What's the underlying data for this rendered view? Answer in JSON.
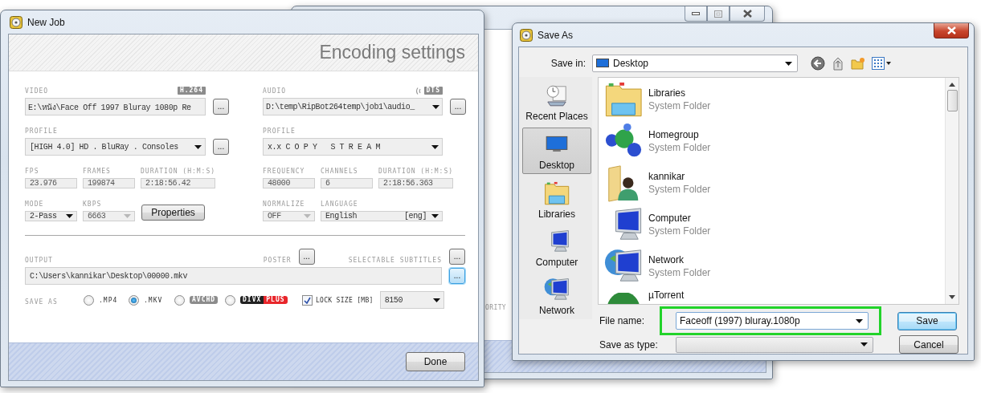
{
  "back_window": {
    "buttons": [
      {
        "kind": "minimize"
      },
      {
        "kind": "maximize"
      },
      {
        "kind": "close"
      }
    ],
    "label_fragment": "ORITY"
  },
  "new_job": {
    "title": "New Job",
    "header": "Encoding settings",
    "columns": [
      {
        "kind": "video",
        "label": "VIDEO",
        "badge": "H.264",
        "source": {
          "value": "E:\\หนัง\\Face Off 1997 Bluray 1080p Re",
          "dropdown": false
        },
        "browse": "...",
        "profile": {
          "label": "PROFILE",
          "value": "[HIGH 4.0] HD . BluRay . Consoles",
          "browse": "..."
        },
        "stats": [
          {
            "label": "FPS",
            "value": "23.976"
          },
          {
            "label": "FRAMES",
            "value": "199874"
          },
          {
            "label": "DURATION (H:M:S)",
            "value": "2:18:56.42"
          }
        ],
        "options": [
          {
            "kind": "select",
            "label": "MODE",
            "value": "2-Pass",
            "disabled": false
          },
          {
            "kind": "select",
            "label": "KBPS",
            "value": "6663",
            "disabled": true
          },
          {
            "kind": "button",
            "text": "Properties"
          }
        ]
      },
      {
        "kind": "audio",
        "label": "AUDIO",
        "badge": "DTS",
        "source": {
          "value": "D:\\temp\\RipBot264temp\\job1\\audio_",
          "dropdown": true
        },
        "browse": "...",
        "profile": {
          "label": "PROFILE",
          "value": "x.x C O P Y   S T R E A M"
        },
        "stats": [
          {
            "label": "FREQUENCY",
            "value": "48000"
          },
          {
            "label": "CHANNELS",
            "value": "6"
          },
          {
            "label": "DURATION (H:M:S)",
            "value": "2:18:56.363"
          }
        ],
        "options": [
          {
            "kind": "select",
            "label": "NORMALIZE",
            "value": "OFF",
            "disabled": true
          },
          {
            "kind": "language",
            "label": "LANGUAGE",
            "value": "English",
            "code": "[eng]",
            "disabled": false
          }
        ]
      }
    ],
    "output": {
      "label": "OUTPUT",
      "path": "C:\\Users\\kannikar\\Desktop\\00000.mkv",
      "browse": {
        "text": "...",
        "focused": true
      },
      "poster": {
        "label": "POSTER",
        "browse": "..."
      },
      "subtitles": {
        "label": "SELECTABLE SUBTITLES",
        "browse": "..."
      }
    },
    "save_as": {
      "label": "SAVE AS",
      "formats": [
        {
          "kind": "text",
          "label": ".MP4",
          "selected": false
        },
        {
          "kind": "text",
          "label": ".MKV",
          "selected": true
        },
        {
          "kind": "badge",
          "label": "AVCHD",
          "selected": false
        },
        {
          "kind": "split_badge",
          "label": "DIVX",
          "label_2": "PLUS",
          "selected": false
        }
      ],
      "lock_size": {
        "label": "LOCK SIZE [MB]",
        "checked": true,
        "value": "8150"
      }
    },
    "done": "Done"
  },
  "save_dialog": {
    "title": "Save As",
    "save_in": {
      "label": "Save in:",
      "value": "Desktop"
    },
    "toolbar": [
      {
        "kind": "back"
      },
      {
        "kind": "up"
      },
      {
        "kind": "new_folder"
      },
      {
        "kind": "views"
      }
    ],
    "places": [
      {
        "kind": "recent",
        "label": "Recent Places",
        "selected": false
      },
      {
        "kind": "desktop",
        "label": "Desktop",
        "selected": true
      },
      {
        "kind": "libraries",
        "label": "Libraries",
        "selected": false
      },
      {
        "kind": "computer",
        "label": "Computer",
        "selected": false
      },
      {
        "kind": "network",
        "label": "Network",
        "selected": false
      }
    ],
    "files": [
      {
        "kind": "libraries",
        "name": "Libraries",
        "type": "System Folder"
      },
      {
        "kind": "homegroup",
        "name": "Homegroup",
        "type": "System Folder"
      },
      {
        "kind": "user",
        "name": "kannikar",
        "type": "System Folder"
      },
      {
        "kind": "computer",
        "name": "Computer",
        "type": "System Folder"
      },
      {
        "kind": "network",
        "name": "Network",
        "type": "System Folder"
      },
      {
        "kind": "utorrent",
        "name": "µTorrent"
      }
    ],
    "file_name": {
      "label": "File name:",
      "value": "Faceoff (1997) bluray.1080p",
      "highlighted": true
    },
    "save_as_type": {
      "label": "Save as type:"
    },
    "buttons": [
      {
        "label": "Save",
        "default": true
      },
      {
        "label": "Cancel",
        "default": false
      }
    ]
  }
}
